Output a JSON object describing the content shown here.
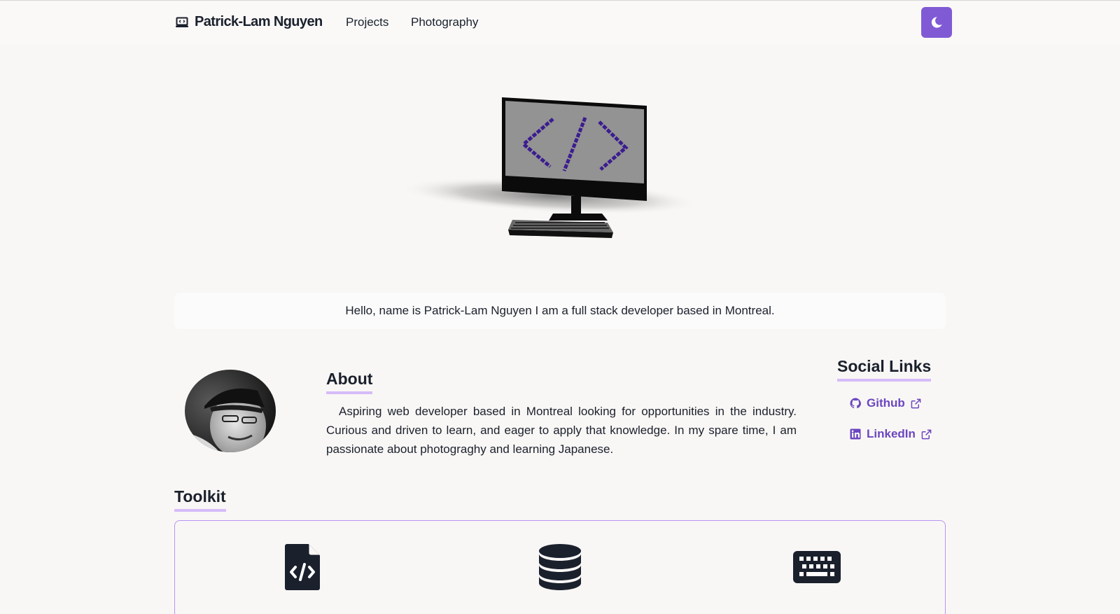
{
  "nav": {
    "brand": "Patrick-Lam Nguyen",
    "links": [
      "Projects",
      "Photography"
    ],
    "theme_toggle_icon": "moon-icon"
  },
  "hero": {
    "image": "pixel-computer-monitor-with-code-symbol"
  },
  "greeting": "Hello, name is Patrick-Lam Nguyen I am a full stack developer based in Montreal.",
  "about": {
    "title": "About",
    "text": "Aspiring web developer based in Montreal looking for opportunities in the industry. Curious and driven to learn, and eager to apply that knowledge. In my spare time, I am passionate about photograghy and learning Japanese."
  },
  "social": {
    "title": "Social Links",
    "links": [
      {
        "label": "Github",
        "icon": "github-icon"
      },
      {
        "label": "LinkedIn",
        "icon": "linkedin-icon"
      }
    ]
  },
  "toolkit": {
    "title": "Toolkit",
    "icons": [
      "file-code-icon",
      "database-icon",
      "keyboard-icon"
    ]
  },
  "colors": {
    "accent": "#805ad5",
    "link": "#6b46c1",
    "underline": "#d6bcfa",
    "background": "#f9f7f5"
  }
}
